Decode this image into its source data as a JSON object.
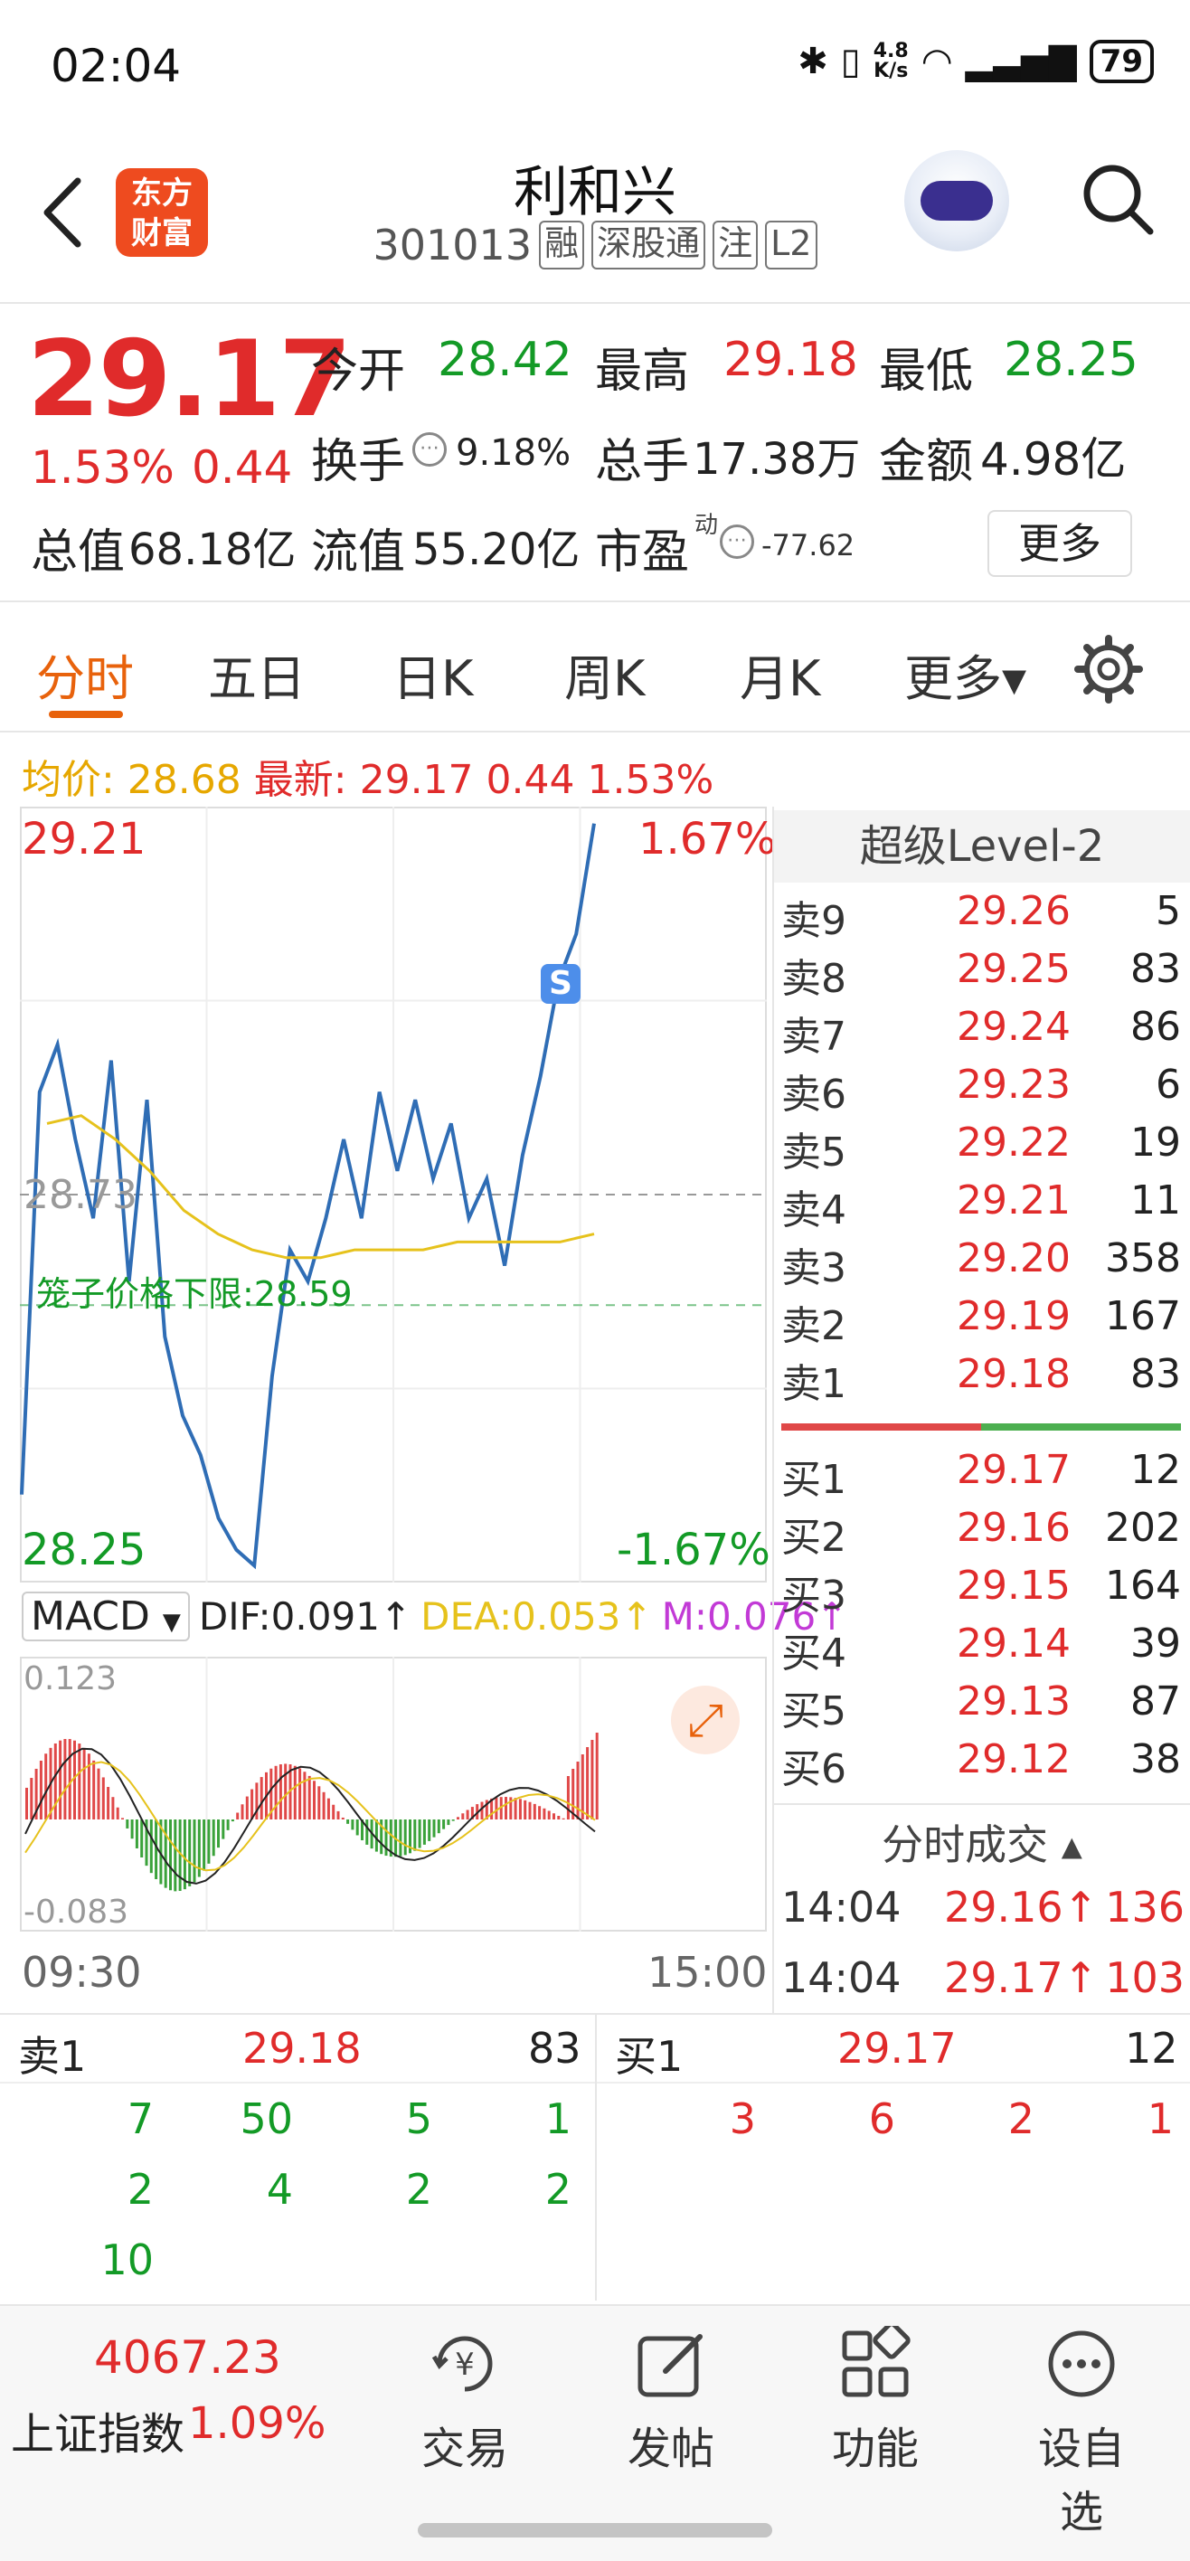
{
  "status": {
    "time": "02:04",
    "net_speed": "4.8\nK/s",
    "battery": "79"
  },
  "header": {
    "logo_text": "东方\n财富",
    "stock_name": "利和兴",
    "stock_code": "301013",
    "tags": [
      "融",
      "深股通",
      "注",
      "L2"
    ]
  },
  "quote": {
    "price": "29.17",
    "pct": "1.53%",
    "change": "0.44",
    "open_label": "今开",
    "open": "28.42",
    "high_label": "最高",
    "high": "29.18",
    "low_label": "最低",
    "low": "28.25",
    "turnover_label": "换手",
    "turnover": "9.18%",
    "volume_label": "总手",
    "volume": "17.38万",
    "amount_label": "金额",
    "amount": "4.98亿",
    "mcap_label": "总值",
    "mcap": "68.18亿",
    "float_label": "流值",
    "float": "55.20亿",
    "pe_label": "市盈",
    "pe_sup": "动",
    "pe": "-77.62",
    "more_label": "更多"
  },
  "tabs": [
    "分时",
    "五日",
    "日K",
    "周K",
    "月K",
    "更多▾"
  ],
  "intraday": {
    "avg_label": "均价: 28.68",
    "latest_label": "最新: 29.17 0.44 1.53%",
    "price_high": "29.21",
    "pct_high": "1.67%",
    "price_low": "28.25",
    "pct_low": "-1.67%",
    "mid_price": "28.73",
    "cage_label": "笼子价格下限:28.59",
    "marker": "S",
    "time_start": "09:30",
    "time_end": "15:00"
  },
  "macd": {
    "selector": "MACD",
    "dif": "DIF:0.091↑",
    "dea": "DEA:0.053↑",
    "m": "M:0.076↑",
    "axis_high": "0.123",
    "axis_low": "-0.083"
  },
  "chart_data": {
    "type": "line",
    "x": [
      "09:30",
      "15:00"
    ],
    "ylim": [
      28.25,
      29.21
    ],
    "series": [
      {
        "values": [
          28.35,
          28.86,
          28.92,
          28.8,
          28.7,
          28.9,
          28.62,
          28.85,
          28.55,
          28.45,
          28.4,
          28.32,
          28.28,
          28.26,
          28.5,
          28.66,
          28.62,
          28.7,
          28.8,
          28.7,
          28.86,
          28.76,
          28.85,
          28.75,
          28.82,
          28.7,
          28.75,
          28.64,
          28.78,
          28.88,
          29.0,
          29.06,
          29.2
        ]
      },
      {
        "values": [
          28.82,
          28.83,
          28.8,
          28.76,
          28.71,
          28.68,
          28.66,
          28.65,
          28.65,
          28.66,
          28.66,
          28.66,
          28.67,
          28.67,
          28.67,
          28.67,
          28.68
        ]
      }
    ]
  },
  "level2": {
    "title": "超级Level-2",
    "asks": [
      {
        "label": "卖9",
        "price": "29.26",
        "vol": "5"
      },
      {
        "label": "卖8",
        "price": "29.25",
        "vol": "83"
      },
      {
        "label": "卖7",
        "price": "29.24",
        "vol": "86"
      },
      {
        "label": "卖6",
        "price": "29.23",
        "vol": "6"
      },
      {
        "label": "卖5",
        "price": "29.22",
        "vol": "19"
      },
      {
        "label": "卖4",
        "price": "29.21",
        "vol": "11"
      },
      {
        "label": "卖3",
        "price": "29.20",
        "vol": "358"
      },
      {
        "label": "卖2",
        "price": "29.19",
        "vol": "167"
      },
      {
        "label": "卖1",
        "price": "29.18",
        "vol": "83"
      }
    ],
    "bids": [
      {
        "label": "买1",
        "price": "29.17",
        "vol": "12"
      },
      {
        "label": "买2",
        "price": "29.16",
        "vol": "202"
      },
      {
        "label": "买3",
        "price": "29.15",
        "vol": "164"
      },
      {
        "label": "买4",
        "price": "29.14",
        "vol": "39"
      },
      {
        "label": "买5",
        "price": "29.13",
        "vol": "87"
      },
      {
        "label": "买6",
        "price": "29.12",
        "vol": "38"
      }
    ],
    "ticks_title": "分时成交 ▴",
    "ticks": [
      {
        "time": "14:04",
        "price": "29.16↑",
        "vol": "136"
      },
      {
        "time": "14:04",
        "price": "29.17↑",
        "vol": "103"
      }
    ]
  },
  "queue": {
    "sell_label": "卖1",
    "sell_price": "29.18",
    "sell_vol": "83",
    "buy_label": "买1",
    "buy_price": "29.17",
    "buy_vol": "12",
    "sell_rows": [
      [
        "7",
        "50",
        "5",
        "1"
      ],
      [
        "2",
        "4",
        "2",
        "2"
      ],
      [
        "10"
      ]
    ],
    "buy_rows": [
      [
        "3",
        "6",
        "2",
        "1"
      ]
    ]
  },
  "bottom": {
    "index_value": "4067.23",
    "index_name": "上证指数",
    "index_pct": "1.09%",
    "nav": [
      "交易",
      "发帖",
      "功能",
      "设自选"
    ]
  },
  "colors": {
    "up": "#e02b2b",
    "down": "#139a26",
    "accent": "#e8620c",
    "price_line": "#2f6db5",
    "avg_line": "#e6c21c"
  }
}
